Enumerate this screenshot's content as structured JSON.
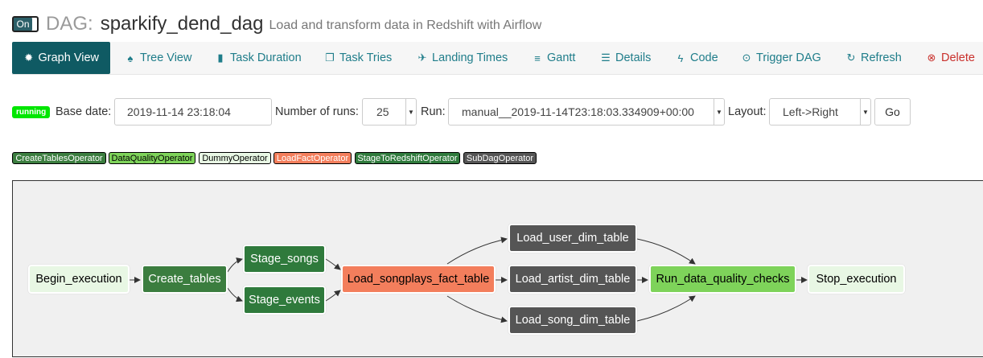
{
  "header": {
    "toggle_label": "On",
    "dag_prefix": "DAG:",
    "dag_id": "sparkify_dend_dag",
    "description": "Load and transform data in Redshift with Airflow"
  },
  "nav": {
    "graph_view": "Graph View",
    "tree_view": "Tree View",
    "task_duration": "Task Duration",
    "task_tries": "Task Tries",
    "landing_times": "Landing Times",
    "gantt": "Gantt",
    "details": "Details",
    "code": "Code",
    "trigger_dag": "Trigger DAG",
    "refresh": "Refresh",
    "delete": "Delete"
  },
  "controls": {
    "state_badge": "running",
    "base_date_label": "Base date:",
    "base_date_value": "2019-11-14 23:18:04",
    "num_runs_label": "Number of runs:",
    "num_runs_value": "25",
    "run_label": "Run:",
    "run_value": "manual__2019-11-14T23:18:03.334909+00:00",
    "layout_label": "Layout:",
    "layout_value": "Left->Right",
    "go_label": "Go"
  },
  "legend": [
    {
      "label": "CreateTablesOperator",
      "color": "#3b7d3f",
      "text": "#ffffff"
    },
    {
      "label": "DataQualityOperator",
      "color": "#7ed35a",
      "text": "#000000"
    },
    {
      "label": "DummyOperator",
      "color": "#e8f7e4",
      "text": "#000000"
    },
    {
      "label": "LoadFactOperator",
      "color": "#f37e5c",
      "text": "#ffffff"
    },
    {
      "label": "StageToRedshiftOperator",
      "color": "#2f7a3c",
      "text": "#ffffff"
    },
    {
      "label": "SubDagOperator",
      "color": "#555555",
      "text": "#ffffff"
    }
  ],
  "graph": {
    "tasks": {
      "begin": "Begin_execution",
      "create": "Create_tables",
      "stage_songs": "Stage_songs",
      "stage_events": "Stage_events",
      "load_fact": "Load_songplays_fact_table",
      "user_dim": "Load_user_dim_table",
      "artist_dim": "Load_artist_dim_table",
      "song_dim": "Load_song_dim_table",
      "quality": "Run_data_quality_checks",
      "stop": "Stop_execution"
    }
  },
  "colors": {
    "nav_active": "#0f5a63",
    "link": "#1f7d8a",
    "delete": "#c9302c",
    "running": "#00e600"
  }
}
